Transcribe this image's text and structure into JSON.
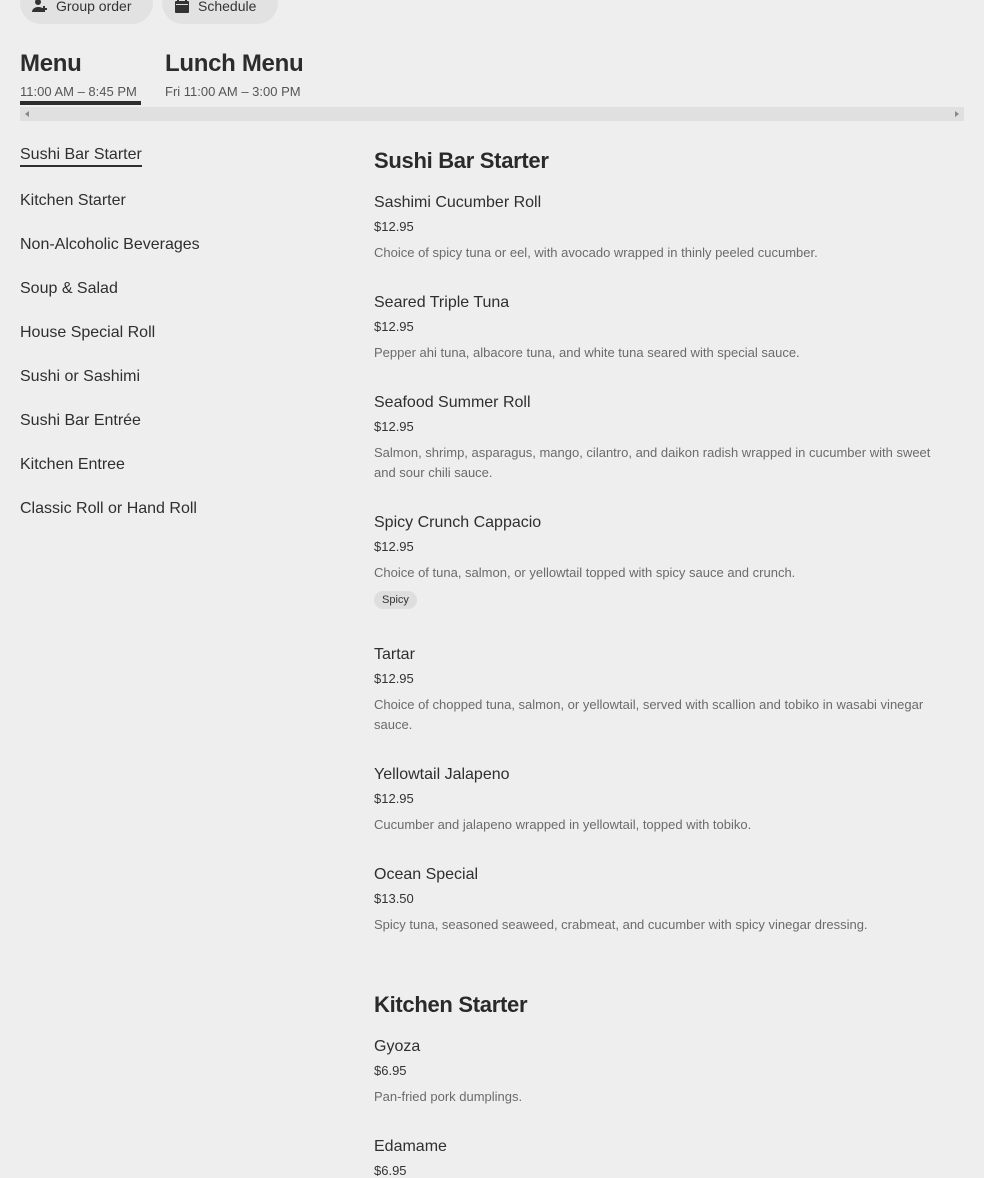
{
  "top_actions": {
    "group_order": "Group order",
    "schedule": "Schedule"
  },
  "menus": [
    {
      "title": "Menu",
      "hours": "11:00 AM – 8:45 PM",
      "active": true
    },
    {
      "title": "Lunch Menu",
      "hours": "Fri 11:00 AM – 3:00 PM",
      "active": false
    }
  ],
  "sidebar": {
    "items": [
      "Sushi Bar Starter",
      "Kitchen Starter",
      "Non-Alcoholic Beverages",
      "Soup & Salad",
      "House Special Roll",
      "Sushi or Sashimi",
      "Sushi Bar Entrée",
      "Kitchen Entree",
      "Classic Roll or Hand Roll"
    ]
  },
  "sections": [
    {
      "title": "Sushi Bar Starter",
      "items": [
        {
          "name": "Sashimi Cucumber Roll",
          "price": "$12.95",
          "desc": "Choice of spicy tuna or eel, with avocado wrapped in thinly peeled cucumber."
        },
        {
          "name": "Seared Triple Tuna",
          "price": "$12.95",
          "desc": "Pepper ahi tuna, albacore tuna, and white tuna seared with special sauce."
        },
        {
          "name": "Seafood Summer Roll",
          "price": "$12.95",
          "desc": "Salmon, shrimp, asparagus, mango, cilantro, and daikon radish wrapped in cucumber with sweet and sour chili sauce."
        },
        {
          "name": "Spicy Crunch Cappacio",
          "price": "$12.95",
          "desc": "Choice of tuna, salmon, or yellowtail topped with spicy sauce and crunch.",
          "tag": "Spicy"
        },
        {
          "name": "Tartar",
          "price": "$12.95",
          "desc": "Choice of chopped tuna, salmon, or yellowtail, served with scallion and tobiko in wasabi vinegar sauce."
        },
        {
          "name": "Yellowtail Jalapeno",
          "price": "$12.95",
          "desc": "Cucumber and jalapeno wrapped in yellowtail, topped with tobiko."
        },
        {
          "name": "Ocean Special",
          "price": "$13.50",
          "desc": "Spicy tuna, seasoned seaweed, crabmeat, and cucumber with spicy vinegar dressing."
        }
      ]
    },
    {
      "title": "Kitchen Starter",
      "items": [
        {
          "name": "Gyoza",
          "price": "$6.95",
          "desc": "Pan-fried pork dumplings."
        },
        {
          "name": "Edamame",
          "price": "$6.95",
          "desc": ""
        }
      ]
    }
  ]
}
